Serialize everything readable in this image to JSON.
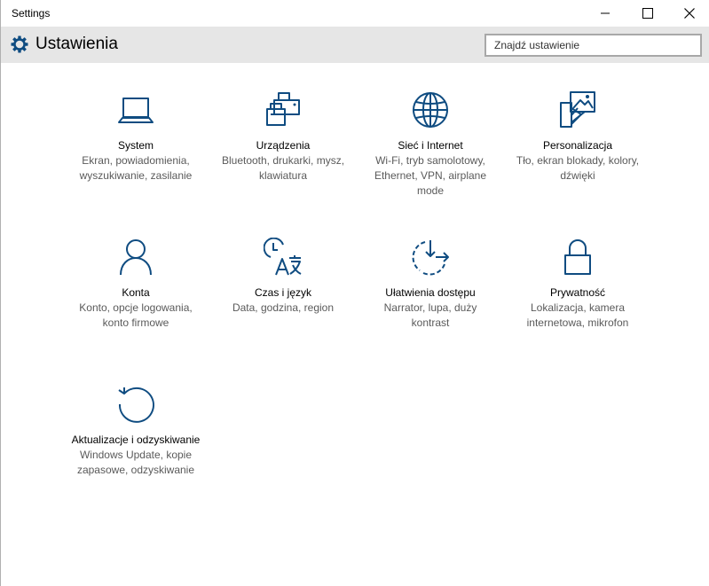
{
  "window": {
    "title": "Settings"
  },
  "header": {
    "title": "Ustawienia",
    "search_placeholder": "Znajdź ustawienie"
  },
  "colors": {
    "accent": "#0f4c81",
    "header_bg": "#e6e6e6",
    "description_text": "#5a5a5a"
  },
  "tiles": [
    {
      "icon": "laptop-icon",
      "name": "System",
      "description": "Ekran, powiadomienia, wyszukiwanie, zasilanie"
    },
    {
      "icon": "printer-icon",
      "name": "Urządzenia",
      "description": "Bluetooth, drukarki, mysz, klawiatura"
    },
    {
      "icon": "globe-icon",
      "name": "Sieć i Internet",
      "description": "Wi-Fi, tryb samolotowy, Ethernet, VPN, airplane mode"
    },
    {
      "icon": "personalization-icon",
      "name": "Personalizacja",
      "description": "Tło, ekran blokady, kolory, dźwięki"
    },
    {
      "icon": "person-icon",
      "name": "Konta",
      "description": "Konto, opcje logowania, konto firmowe"
    },
    {
      "icon": "time-language-icon",
      "name": "Czas i język",
      "description": "Data, godzina, region"
    },
    {
      "icon": "ease-of-access-icon",
      "name": "Ułatwienia dostępu",
      "description": "Narrator, lupa, duży kontrast"
    },
    {
      "icon": "lock-icon",
      "name": "Prywatność",
      "description": "Lokalizacja, kamera internetowa, mikrofon"
    },
    {
      "icon": "update-icon",
      "name": "Aktualizacje i odzyskiwanie",
      "description": "Windows Update, kopie zapasowe, odzyskiwanie"
    }
  ]
}
